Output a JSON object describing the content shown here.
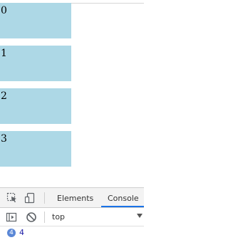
{
  "boxes": [
    {
      "label": "0"
    },
    {
      "label": "1"
    },
    {
      "label": "2"
    },
    {
      "label": "3"
    }
  ],
  "devtools": {
    "tabs": [
      {
        "label": "Elements",
        "active": false
      },
      {
        "label": "Console",
        "active": true
      }
    ],
    "icons": [
      "inspect-element-icon",
      "device-toolbar-icon",
      "sidebar-toggle-icon",
      "clear-console-icon"
    ],
    "context": "top",
    "output": {
      "badge_count": "4",
      "value": "4"
    },
    "accent_color": "#1a73e8"
  },
  "colors": {
    "box_background": "#add8e6"
  }
}
